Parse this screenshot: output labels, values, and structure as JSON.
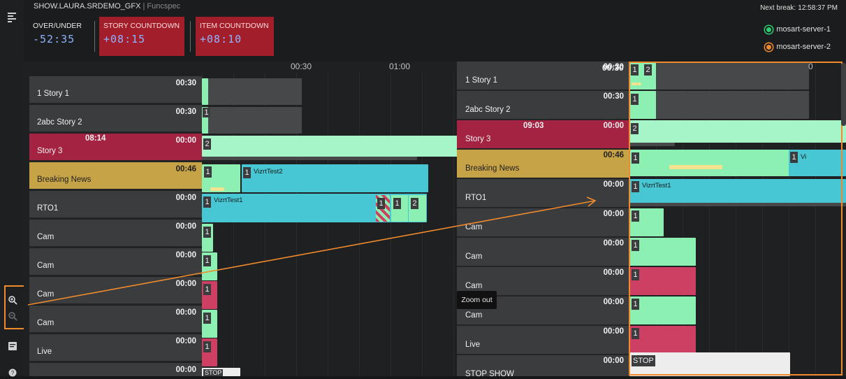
{
  "header": {
    "show_name": "SHOW.LAURA.SRDEMO_GFX",
    "separator": "|",
    "mode": "Funcspec",
    "next_break_label": "Next break:",
    "next_break_time": "12:58:37 PM",
    "countdowns": [
      {
        "label": "OVER/UNDER",
        "value": "-52:35"
      },
      {
        "label": "STORY COUNTDOWN",
        "value": "+08:15"
      },
      {
        "label": "ITEM COUNTDOWN",
        "value": "+08:10"
      }
    ],
    "servers": [
      {
        "name": "mosart-server-1",
        "color": "#2ecc71"
      },
      {
        "name": "mosart-server-2",
        "color": "#f08a2d"
      }
    ]
  },
  "timeline": {
    "ticks": [
      "00:30",
      "01:00"
    ]
  },
  "rows": [
    {
      "name": "1 Story 1",
      "duration": "00:30",
      "planned": ""
    },
    {
      "name": "2abc Story 2",
      "duration": "00:30",
      "planned": ""
    },
    {
      "name": "Story 3",
      "duration": "00:00",
      "planned": "08:14"
    },
    {
      "name": "Breaking News",
      "duration": "00:46",
      "planned": ""
    },
    {
      "name": "RTO1",
      "duration": "00:00",
      "planned": ""
    },
    {
      "name": "Cam",
      "duration": "00:00",
      "planned": ""
    },
    {
      "name": "Cam",
      "duration": "00:00",
      "planned": ""
    },
    {
      "name": "Cam",
      "duration": "00:00",
      "planned": ""
    },
    {
      "name": "Cam",
      "duration": "00:00",
      "planned": ""
    },
    {
      "name": "Live",
      "duration": "00:00",
      "planned": ""
    },
    {
      "name": "",
      "duration": "00:00",
      "planned": ""
    }
  ],
  "items": {
    "vizrt_test2": "VizrtTest2",
    "vizrt_test1": "VizrtTest1",
    "stop": "STOP",
    "n1": "1",
    "n2": "2"
  },
  "zoom_panel": {
    "tick": "00:30",
    "tick_right": "0",
    "rows": [
      {
        "name": "1 Story 1",
        "duration": "00:30",
        "planned": ""
      },
      {
        "name": "2abc Story 2",
        "duration": "00:30",
        "planned": ""
      },
      {
        "name": "Story 3",
        "duration": "00:00",
        "planned": "09:03"
      },
      {
        "name": "Breaking News",
        "duration": "00:46",
        "planned": ""
      },
      {
        "name": "RTO1",
        "duration": "00:00",
        "planned": ""
      },
      {
        "name": "Cam",
        "duration": "00:00",
        "planned": ""
      },
      {
        "name": "Cam",
        "duration": "00:00",
        "planned": ""
      },
      {
        "name": "Cam",
        "duration": "00:00",
        "planned": ""
      },
      {
        "name": "Cam",
        "duration": "00:00",
        "planned": ""
      },
      {
        "name": "Live",
        "duration": "00:00",
        "planned": ""
      },
      {
        "name": "STOP SHOW",
        "duration": "00:00",
        "planned": ""
      }
    ],
    "tooltip": "Zoom out",
    "vizrt_partial": "Vi"
  },
  "sidebar": {
    "icons": [
      "menu-icon",
      "zoom-in-icon",
      "zoom-out-icon",
      "notes-icon",
      "help-icon"
    ]
  },
  "colors": {
    "highlight": "#f08a2d",
    "story_red": "#a52342",
    "breaking_gold": "#c7a347",
    "cyan": "#47c6d3",
    "green": "#8df0b3"
  }
}
